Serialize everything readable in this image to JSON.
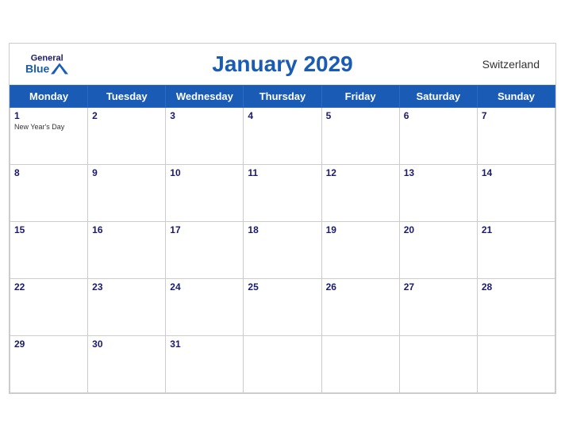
{
  "header": {
    "title": "January 2029",
    "country": "Switzerland",
    "logo": {
      "general": "General",
      "blue": "Blue"
    }
  },
  "days_of_week": [
    "Monday",
    "Tuesday",
    "Wednesday",
    "Thursday",
    "Friday",
    "Saturday",
    "Sunday"
  ],
  "weeks": [
    [
      {
        "day": 1,
        "holiday": "New Year's Day"
      },
      {
        "day": 2
      },
      {
        "day": 3
      },
      {
        "day": 4
      },
      {
        "day": 5
      },
      {
        "day": 6
      },
      {
        "day": 7
      }
    ],
    [
      {
        "day": 8
      },
      {
        "day": 9
      },
      {
        "day": 10
      },
      {
        "day": 11
      },
      {
        "day": 12
      },
      {
        "day": 13
      },
      {
        "day": 14
      }
    ],
    [
      {
        "day": 15
      },
      {
        "day": 16
      },
      {
        "day": 17
      },
      {
        "day": 18
      },
      {
        "day": 19
      },
      {
        "day": 20
      },
      {
        "day": 21
      }
    ],
    [
      {
        "day": 22
      },
      {
        "day": 23
      },
      {
        "day": 24
      },
      {
        "day": 25
      },
      {
        "day": 26
      },
      {
        "day": 27
      },
      {
        "day": 28
      }
    ],
    [
      {
        "day": 29
      },
      {
        "day": 30
      },
      {
        "day": 31
      },
      {
        "day": null
      },
      {
        "day": null
      },
      {
        "day": null
      },
      {
        "day": null
      }
    ]
  ]
}
